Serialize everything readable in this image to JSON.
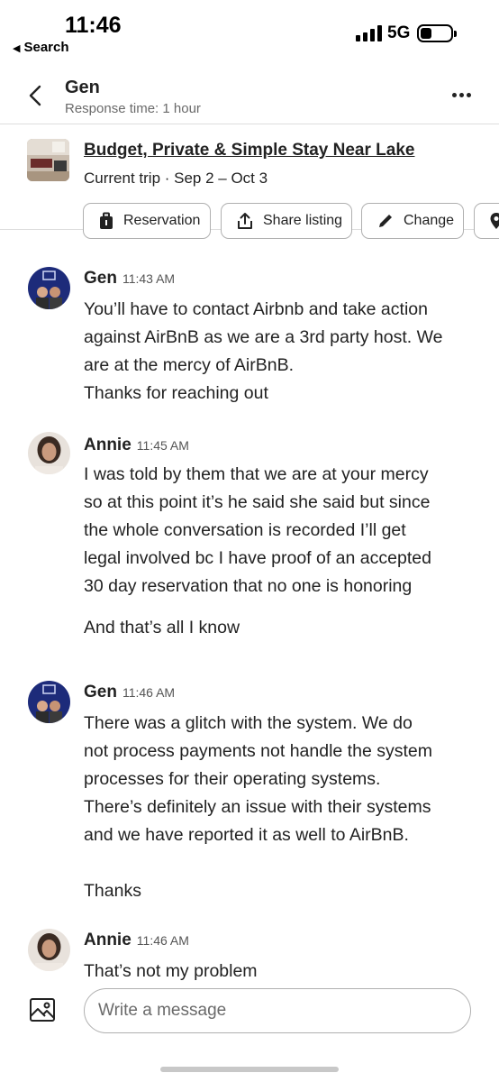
{
  "status_bar": {
    "time": "11:46",
    "back_app": "Search",
    "network": "5G"
  },
  "header": {
    "host_name": "Gen",
    "response_time": "Response time: 1 hour"
  },
  "listing": {
    "title": "Budget, Private & Simple Stay Near Lake",
    "trip": "Current trip · Sep 2 – Oct 3",
    "actions": [
      "Reservation",
      "Share listing",
      "Change"
    ]
  },
  "messages": [
    {
      "sender": "Gen",
      "time": "11:43 AM",
      "lines": [
        "You’ll have to contact Airbnb and take action",
        "against AirBnB as we are a 3rd party host. We",
        "are at the mercy of AirBnB.",
        "Thanks for reaching out"
      ]
    },
    {
      "sender": "Annie",
      "time": "11:45 AM",
      "lines": [
        "I was told by them that we are at your mercy",
        "so at this point it’s he said she said but since",
        "the whole conversation is recorded I’ll get",
        "legal involved bc I have proof of an accepted",
        "30 day reservation that no one is honoring",
        "",
        "And that’s all I know"
      ]
    },
    {
      "sender": "Gen",
      "time": "11:46 AM",
      "lines": [
        "There was a glitch with the system. We do",
        "not process payments not handle the system",
        "processes for their operating systems.",
        "There’s definitely an issue with their systems",
        "and we have reported it as well to AirBnB.",
        "",
        "Thanks"
      ]
    },
    {
      "sender": "Annie",
      "time": "11:46 AM",
      "lines": [
        "That’s not my problem"
      ]
    }
  ],
  "composer": {
    "placeholder": "Write a message"
  }
}
